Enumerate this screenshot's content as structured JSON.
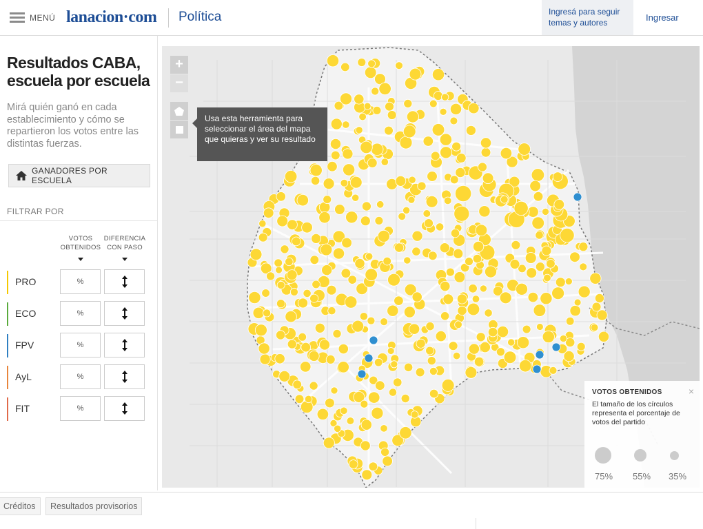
{
  "header": {
    "menu_label": "MENÚ",
    "logo": "lanacion·com",
    "section": "Política",
    "follow_text": "Ingresá para seguir temas y autores",
    "login_label": "Ingresar"
  },
  "sidebar": {
    "title": "Resultados CABA, escuela por escuela",
    "subtitle": "Mirá quién ganó en cada establecimiento y cómo se repartieron los votos entre las distintas fuerzas.",
    "winners_button": "GANADORES POR ESCUELA",
    "filter_title": "FILTRAR POR",
    "col_votes": "VOTOS OBTENIDOS",
    "col_diff": "DIFERENCIA CON PASO",
    "parties": [
      {
        "name": "PRO",
        "color": "#f5c800",
        "pct_label": "%"
      },
      {
        "name": "ECO",
        "color": "#5aaa3c",
        "pct_label": "%"
      },
      {
        "name": "FPV",
        "color": "#2f7fc1",
        "pct_label": "%"
      },
      {
        "name": "AyL",
        "color": "#e8853c",
        "pct_label": "%"
      },
      {
        "name": "FIT",
        "color": "#e06a4a",
        "pct_label": "%"
      }
    ]
  },
  "map": {
    "zoom_in": "+",
    "zoom_out": "−",
    "tooltip": "Usa esta herramienta para seleccionar el área del mapa que quieras y ver su resultado",
    "pro_color": "#fdd835",
    "fpv_color": "#2f8fd0"
  },
  "legend": {
    "title": "VOTOS OBTENIDOS",
    "close": "×",
    "description": "El tamaño de los círculos representa el porcentaje de votos del partido",
    "sizes": [
      "75%",
      "55%",
      "35%"
    ]
  },
  "footer": {
    "credits": "Créditos",
    "provisional": "Resultados provisorios"
  }
}
